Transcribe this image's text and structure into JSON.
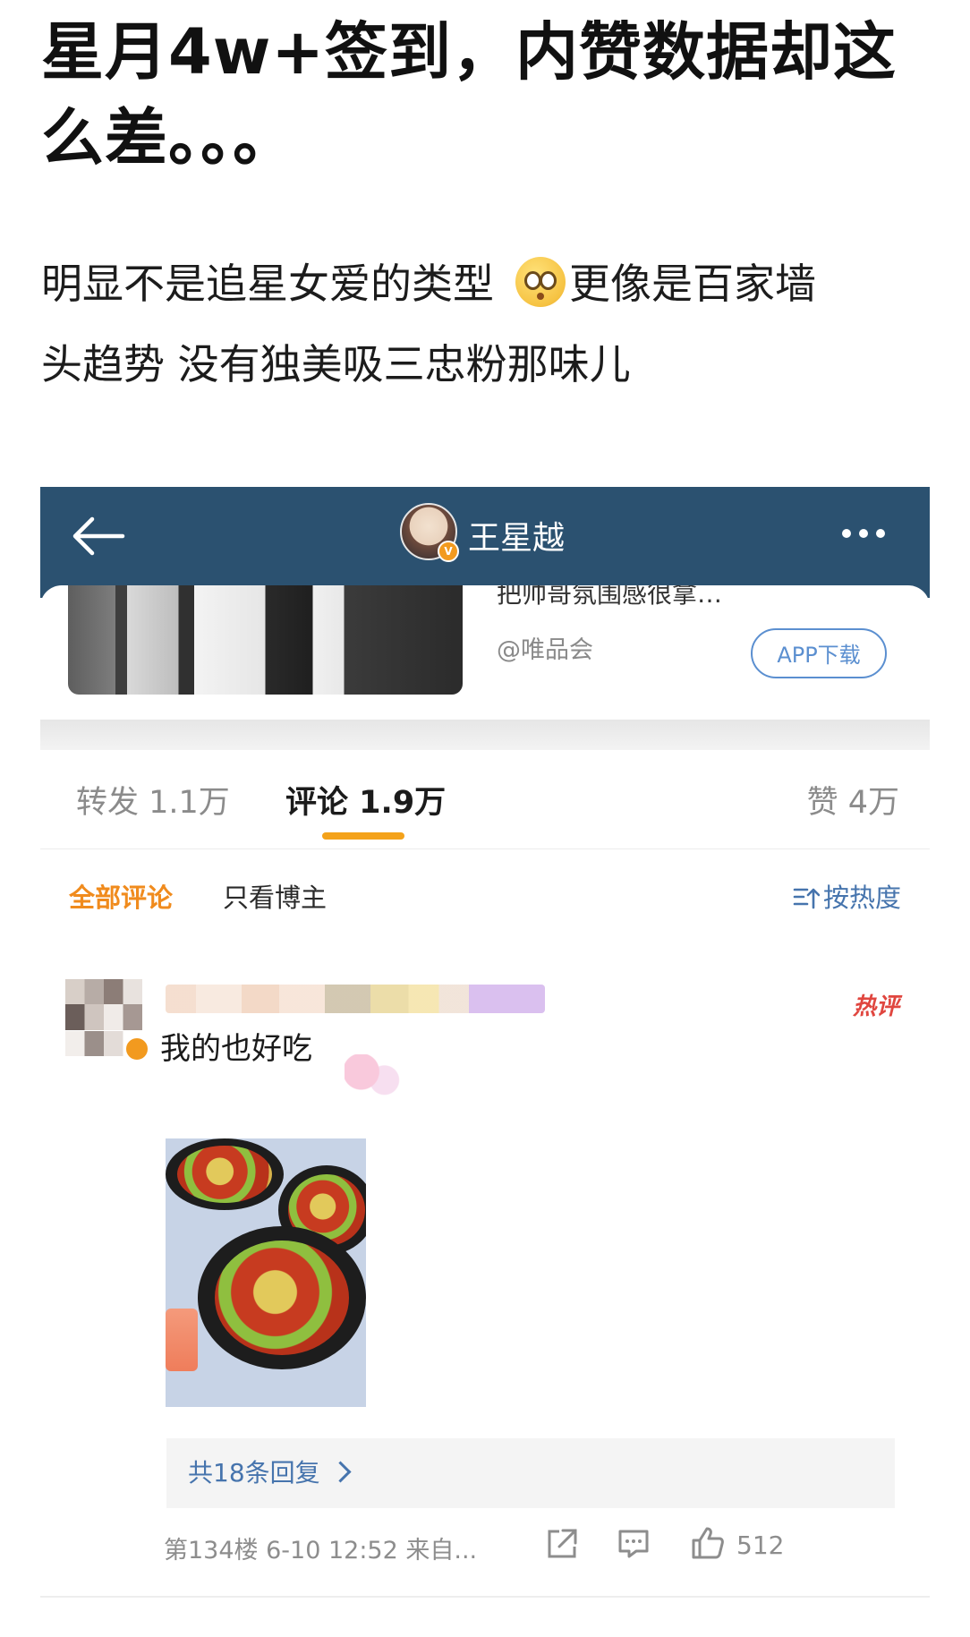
{
  "post": {
    "title_line1": "星月4w+签到，内赞数据却这",
    "title_line2": "么差。。。",
    "body_part1": "明显不是追星女爱的类型",
    "body_part2": "更像是百家墙",
    "body_line2": "头趋势  没有独美吸三忠粉那味儿",
    "emoji_icon": "flushed-face-emoji"
  },
  "screenshot": {
    "header": {
      "account_name": "王星越"
    },
    "ad": {
      "title_cut": "把帅哥氛围感很拿…",
      "source": "@唯品会",
      "app_button": "APP下载"
    },
    "tabs": {
      "forward": "转发 1.1万",
      "comment": "评论 1.9万",
      "like": "赞 4万"
    },
    "filter": {
      "all": "全部评论",
      "blogger_only": "只看博主",
      "sort": "按热度"
    },
    "comment": {
      "hot_badge": "热评",
      "text": "我的也好吃",
      "replies": "共18条回复",
      "meta": "第134楼 6-10 12:52 来自...",
      "likes": "512"
    }
  },
  "colors": {
    "header_bg": "#2b5170",
    "accent_orange": "#f08b1d",
    "link_blue": "#4674ad",
    "hot_red": "#e0463f"
  }
}
